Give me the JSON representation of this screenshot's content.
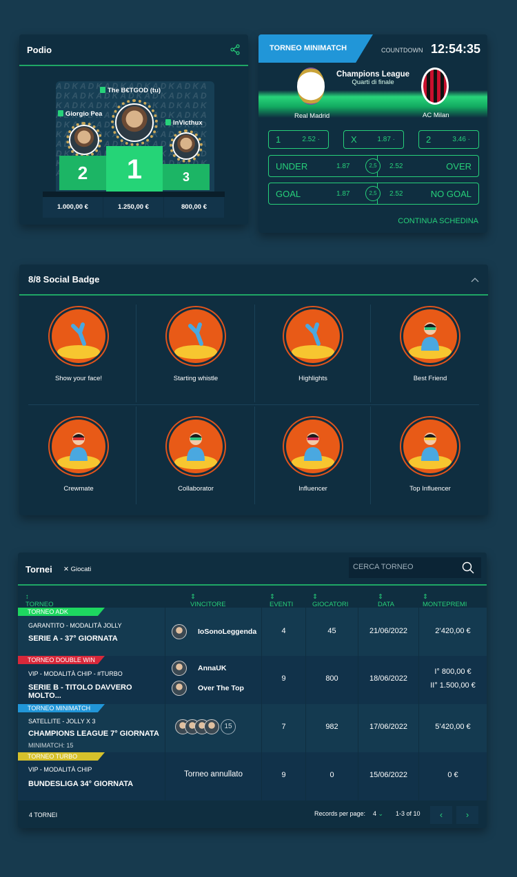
{
  "podio": {
    "title": "Podio",
    "first": {
      "name": "The B€TGOD (tu)",
      "rank": "1",
      "prize": "1.250,00 €"
    },
    "second": {
      "name": "Giorgio Pea",
      "rank": "2",
      "prize": "1.000,00 €"
    },
    "third": {
      "name": "InVicthux",
      "rank": "3",
      "prize": "800,00 €"
    },
    "pattern": "ADKADKADKADKADKADKADKADKADKADKADKADKADKADKADKADKADKADKADKADKADKADKADKADKADKADKADKADKADKADKADKADKADKADKADKADKADKADKADKADKADKADKADKADKADKADKADKADKADKADKADKADKADKADKADKADKADKADKADKADKADK"
  },
  "match": {
    "badge": "TORNEO MINIMATCH",
    "countdown_label": "COUNTDOWN",
    "countdown": "12:54:35",
    "competition": "Champions League",
    "stage": "Quarti di finale",
    "home": "Real Madrid",
    "away": "AC Milan",
    "odds_1x2": [
      {
        "k": "1",
        "v": "2.52"
      },
      {
        "k": "X",
        "v": "1.87"
      },
      {
        "k": "2",
        "v": "3.46"
      }
    ],
    "uo": {
      "left": "UNDER",
      "v1": "1.87",
      "mid": "2,5",
      "v2": "2.52",
      "right": "OVER"
    },
    "gng": {
      "left": "GOAL",
      "v1": "1.87",
      "mid": "2,5",
      "v2": "2.52",
      "right": "NO GOAL"
    },
    "continue": "CONTINUA SCHEDINA"
  },
  "badges": {
    "title": "8/8 Social Badge",
    "items": [
      {
        "label": "Show your face!",
        "icon": "molecule-icon"
      },
      {
        "label": "Starting whistle",
        "icon": "molecule-icon"
      },
      {
        "label": "Highlights",
        "icon": "molecule-icon"
      },
      {
        "label": "Best Friend",
        "icon": "user-badge-icon"
      },
      {
        "label": "Crewmate",
        "icon": "user-badge-icon"
      },
      {
        "label": "Collaborator",
        "icon": "user-badge-icon"
      },
      {
        "label": "Influencer",
        "icon": "user-badge-icon"
      },
      {
        "label": "Top Influencer",
        "icon": "user-badge-icon"
      }
    ]
  },
  "tornei": {
    "title": "Tornei",
    "filter": "Giocati",
    "search_placeholder": "CERCA TORNEO",
    "headers": [
      "TORNEO",
      "VINCITORE",
      "EVENTI",
      "GIOCATORI",
      "DATA",
      "MONTEPREMI"
    ],
    "rows": [
      {
        "tag": "TORNEO ADK",
        "tag_color": "#1ed760",
        "sub": "GARANTITO - MODALITÀ JOLLY",
        "name": "SERIE A - 37° GIORNATA",
        "extra": "",
        "winners": [
          "IoSonoLeggenda"
        ],
        "eventi": "4",
        "giocatori": "45",
        "data": "21/06/2022",
        "prizes": [
          "2’420,00 €"
        ]
      },
      {
        "tag": "TORNEO DOUBLE WIN",
        "tag_color": "#d8283a",
        "sub": "VIP - MODALITÀ CHIP - #TURBO",
        "name": "SERIE B - TITOLO DAVVERO MOLTO...",
        "extra": "",
        "winners": [
          "AnnaUK",
          "Over The Top"
        ],
        "eventi": "9",
        "giocatori": "800",
        "data": "18/06/2022",
        "prizes": [
          "I° 800,00 €",
          "II° 1.500,00 €"
        ]
      },
      {
        "tag": "TORNEO MINIMATCH",
        "tag_color": "#2196d8",
        "sub": "SATELLITE -  JOLLY X 3",
        "name": "CHAMPIONS LEAGUE  7° GIORNATA",
        "extra": "MINIMATCH: 15",
        "winners_count": "15",
        "eventi": "7",
        "giocatori": "982",
        "data": "17/06/2022",
        "prizes": [
          "5’420,00 €"
        ]
      },
      {
        "tag": "TORNEO TURBO",
        "tag_color": "#d6c12b",
        "sub": "VIP - MODALITÀ CHIP",
        "name": "BUNDESLIGA 34° GIORNATA",
        "extra": "",
        "cancelled": "Torneo annullato",
        "eventi": "9",
        "giocatori": "0",
        "data": "15/06/2022",
        "prizes": [
          "0 €"
        ]
      }
    ],
    "footer_count": "4 TORNEI",
    "records_label": "Records per page:",
    "records_value": "4",
    "range": "1-3 of 10"
  }
}
